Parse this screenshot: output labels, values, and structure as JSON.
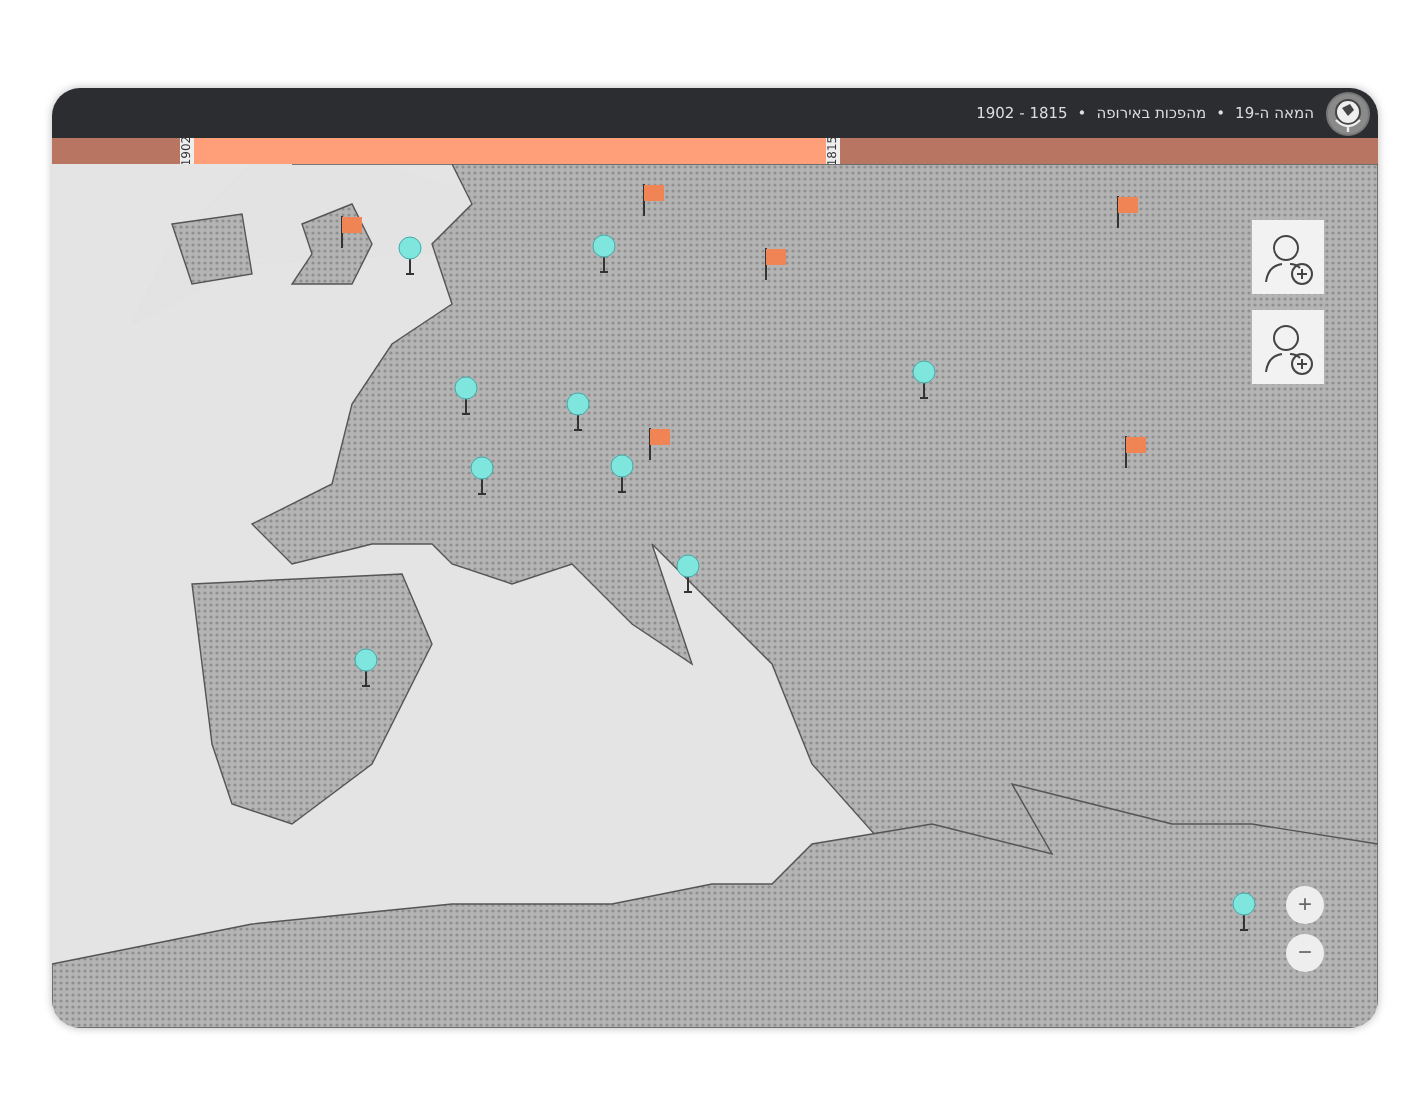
{
  "header": {
    "title_parts": [
      "המאה ה-19",
      "מהפכות באירופה",
      "1815 - 1902"
    ],
    "separator": "•"
  },
  "timeline": {
    "start_label": "1902",
    "end_label": "1815"
  },
  "zoom_controls": [
    "+",
    "−"
  ]
}
